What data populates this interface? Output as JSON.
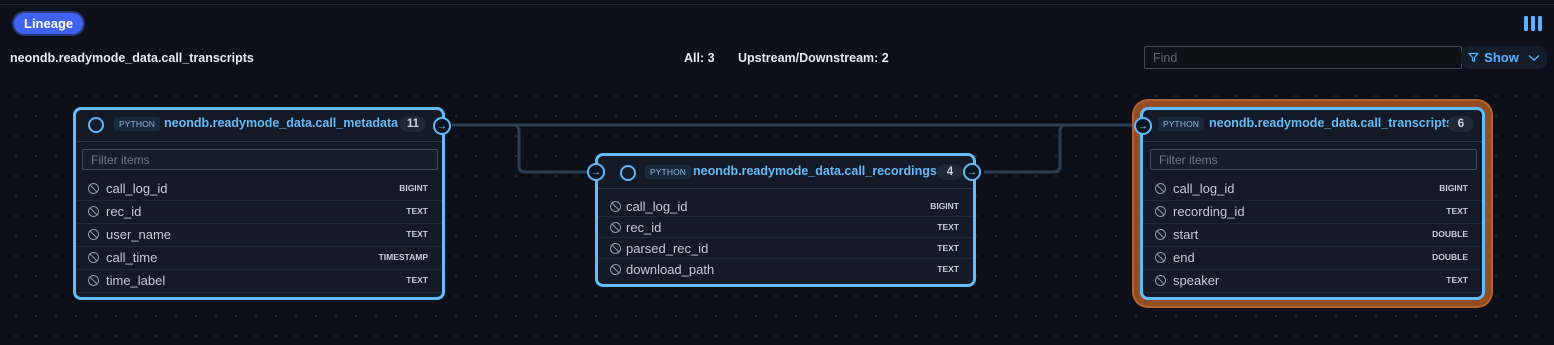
{
  "toolbar": {
    "lineage_tab": "Lineage",
    "title": "neondb.readymode_data.call_transcripts",
    "all_label": "All: 3",
    "updown_label": "Upstream/Downstream: 2",
    "find_placeholder": "Find",
    "show_label": "Show",
    "layout_icon": "columns-icon",
    "filter_icon": "filter-icon",
    "chevron_icon": "chevron-down-icon"
  },
  "nodes": {
    "metadata": {
      "type": "PYTHON",
      "title": "neondb.readymode_data.call_metadata",
      "count": "11",
      "filter_placeholder": "Filter items",
      "columns": [
        {
          "name": "call_log_id",
          "type": "BIGINT"
        },
        {
          "name": "rec_id",
          "type": "TEXT"
        },
        {
          "name": "user_name",
          "type": "TEXT"
        },
        {
          "name": "call_time",
          "type": "TIMESTAMP"
        },
        {
          "name": "time_label",
          "type": "TEXT"
        }
      ]
    },
    "recordings": {
      "type": "PYTHON",
      "title": "neondb.readymode_data.call_recordings",
      "count": "4",
      "columns": [
        {
          "name": "call_log_id",
          "type": "BIGINT"
        },
        {
          "name": "rec_id",
          "type": "TEXT"
        },
        {
          "name": "parsed_rec_id",
          "type": "TEXT"
        },
        {
          "name": "download_path",
          "type": "TEXT"
        }
      ]
    },
    "transcripts": {
      "type": "PYTHON",
      "title": "neondb.readymode_data.call_transcripts",
      "count": "6",
      "filter_placeholder": "Filter items",
      "columns": [
        {
          "name": "call_log_id",
          "type": "BIGINT"
        },
        {
          "name": "recording_id",
          "type": "TEXT"
        },
        {
          "name": "start",
          "type": "DOUBLE"
        },
        {
          "name": "end",
          "type": "DOUBLE"
        },
        {
          "name": "speaker",
          "type": "TEXT"
        }
      ]
    }
  },
  "colors": {
    "accent": "#61bdf7",
    "selected_outline": "#934d22",
    "edge": "#2b3d53",
    "background": "#0d1018"
  }
}
